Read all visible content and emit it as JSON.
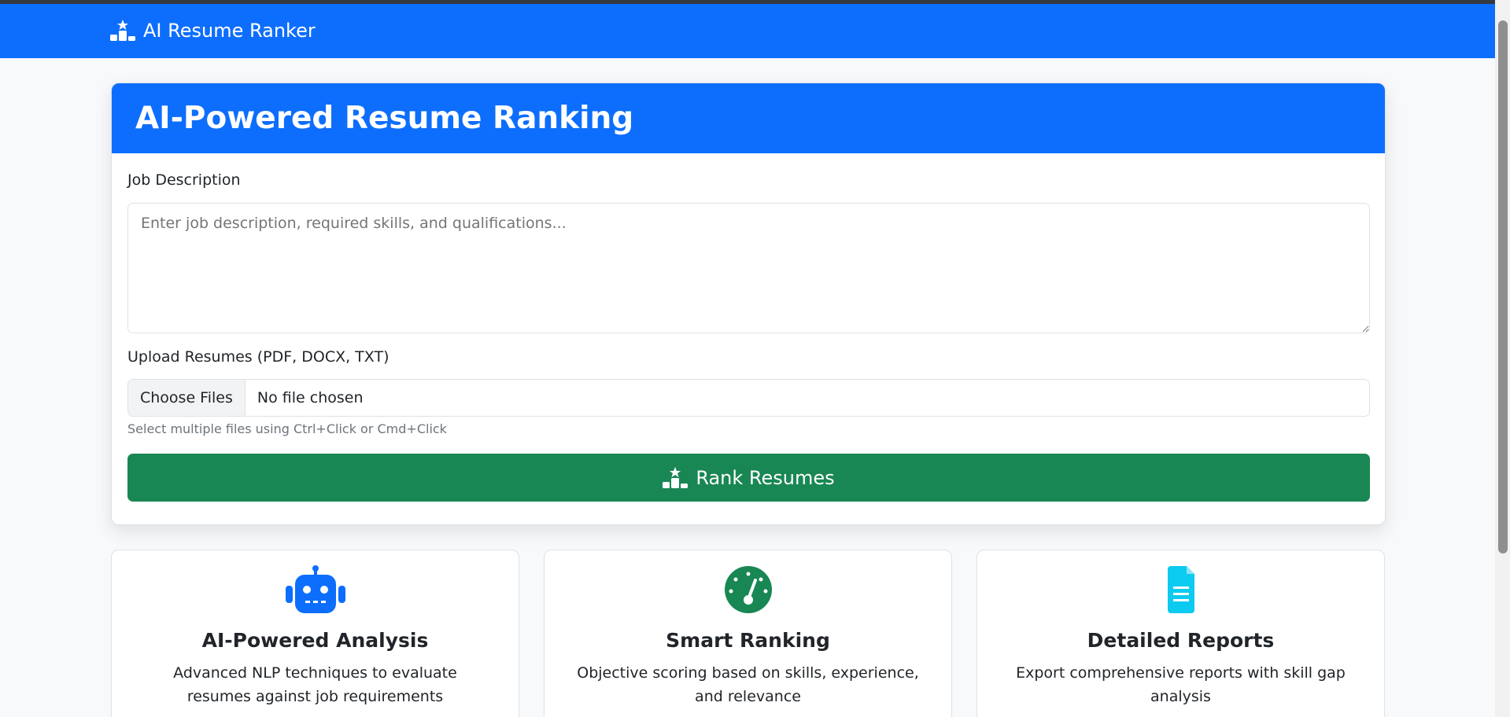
{
  "navbar": {
    "brand": "AI Resume Ranker",
    "brand_icon": "ranking-podium-icon",
    "color": "#0d6efd"
  },
  "main_card": {
    "title": "AI-Powered Resume Ranking",
    "job_description": {
      "label": "Job Description",
      "placeholder": "Enter job description, required skills, and qualifications...",
      "value": ""
    },
    "upload": {
      "label": "Upload Resumes (PDF, DOCX, TXT)",
      "button_label": "Choose Files",
      "status": "No file chosen",
      "hint": "Select multiple files using Ctrl+Click or Cmd+Click"
    },
    "submit": {
      "label": "Rank Resumes",
      "icon": "ranking-podium-icon",
      "color": "#198754"
    }
  },
  "features": [
    {
      "icon": "robot-icon",
      "icon_color": "#0d6efd",
      "title": "AI-Powered Analysis",
      "description": "Advanced NLP techniques to evaluate resumes against job requirements"
    },
    {
      "icon": "speedometer-icon",
      "icon_color": "#198754",
      "title": "Smart Ranking",
      "description": "Objective scoring based on skills, experience, and relevance"
    },
    {
      "icon": "file-text-icon",
      "icon_color": "#0dcaf0",
      "title": "Detailed Reports",
      "description": "Export comprehensive reports with skill gap analysis"
    }
  ]
}
